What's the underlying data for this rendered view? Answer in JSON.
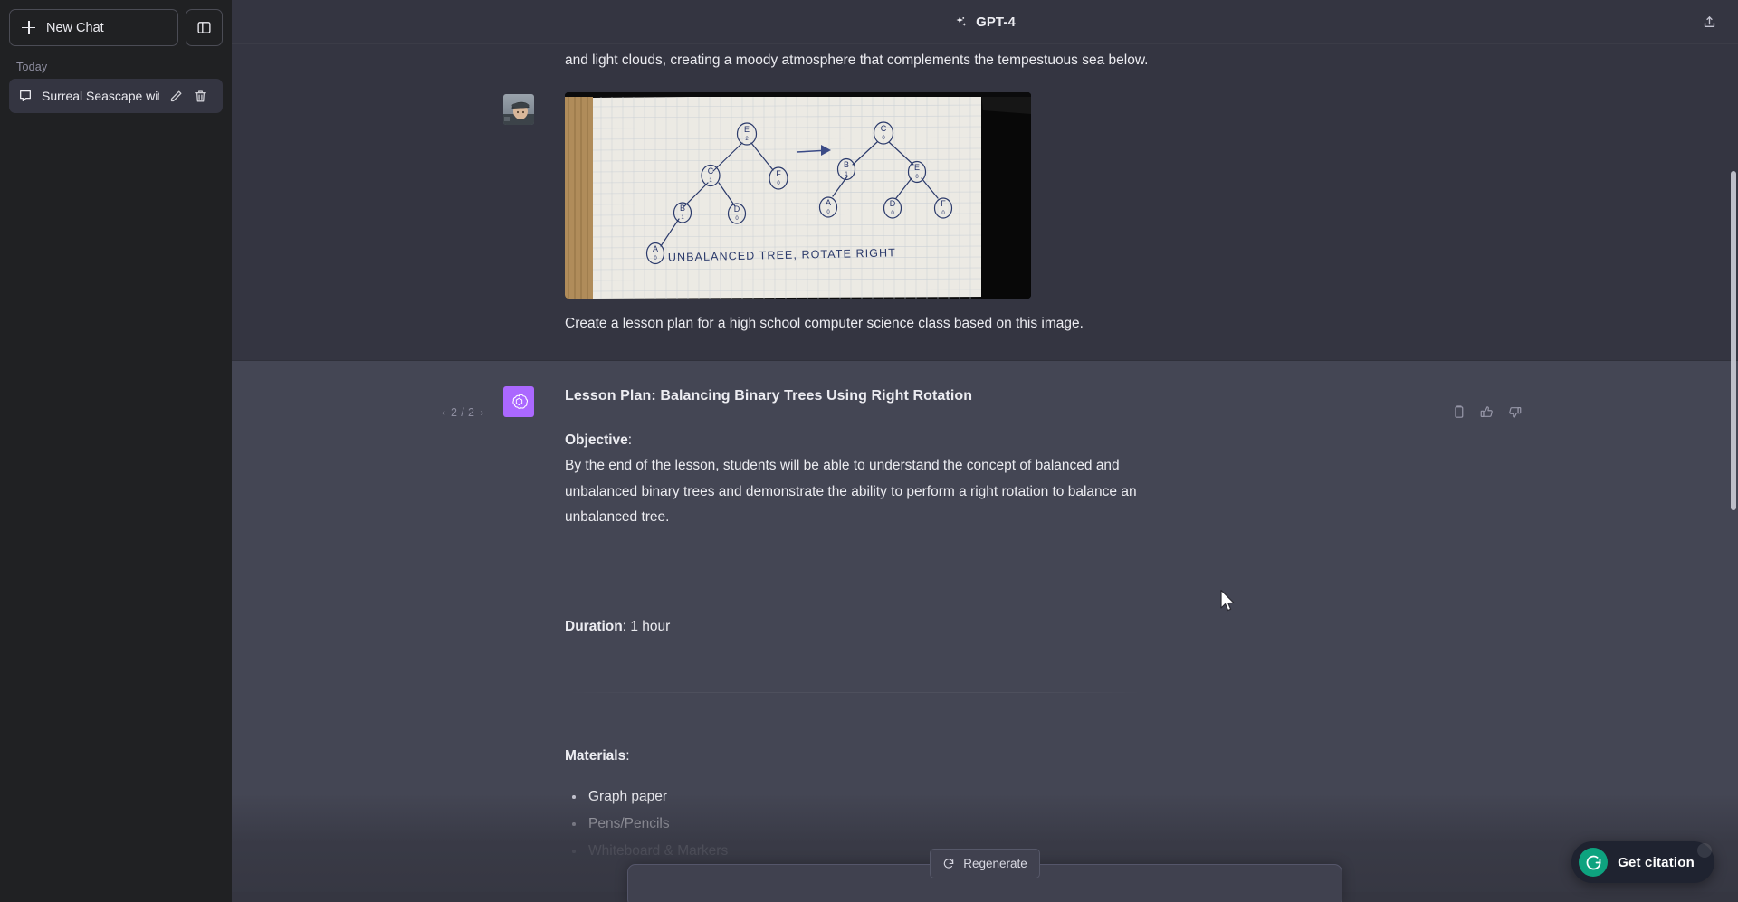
{
  "sidebar": {
    "new_chat_label": "New Chat",
    "new_chat_icon": "plus-icon",
    "panel_toggle_icon": "sidebar-panel-icon",
    "section_label": "Today",
    "chats": [
      {
        "title": "Surreal Seascape with L",
        "icon": "chat-bubble-icon",
        "edit_icon": "pencil-icon",
        "delete_icon": "trash-icon",
        "active": true
      }
    ]
  },
  "header": {
    "model_label": "GPT-4",
    "model_icon": "sparkles-icon",
    "share_icon": "share-upload-icon"
  },
  "conversation": {
    "previous_message_tail": {
      "text": "and light clouds, creating a moody atmosphere that complements the tempestuous sea below."
    },
    "user_turn": {
      "avatar": "user-photo-avatar",
      "attached_image": {
        "alt": "Hand-drawn binary tree rotation diagram on graph paper",
        "caption_in_image": "UNBALANCED TREE, ROTATE RIGHT",
        "left_tree_nodes": [
          "E",
          "C",
          "F",
          "B",
          "D",
          "A"
        ],
        "right_tree_nodes": [
          "C",
          "B",
          "E",
          "A",
          "D",
          "F"
        ]
      },
      "prompt": "Create a lesson plan for a high school computer science class based on this image."
    },
    "assistant_turn": {
      "avatar": "openai-logo-avatar",
      "pager": {
        "prev": "‹",
        "count": "2 / 2",
        "next": "›"
      },
      "actions": [
        {
          "name": "copy-icon",
          "label": "Copy"
        },
        {
          "name": "thumbs-up-icon",
          "label": "Good response"
        },
        {
          "name": "thumbs-down-icon",
          "label": "Bad response"
        }
      ],
      "title": "Lesson Plan: Balancing Binary Trees Using Right Rotation",
      "objective_label": "Objective",
      "objective_text": "By the end of the lesson, students will be able to understand the concept of balanced and unbalanced binary trees and demonstrate the ability to perform a right rotation to balance an unbalanced tree.",
      "duration_label": "Duration",
      "duration_value": "1 hour",
      "materials_label": "Materials",
      "materials": [
        "Graph paper",
        "Pens/Pencils",
        "Whiteboard & Markers"
      ]
    }
  },
  "footer": {
    "regenerate_label": "Regenerate",
    "regenerate_icon": "refresh-icon"
  },
  "citation_widget": {
    "label": "Get citation",
    "icon": "grammarly-g-icon",
    "accent_color": "#0ea37f",
    "background_color": "#1f2330"
  },
  "colors": {
    "sidebar_bg": "#202123",
    "user_turn_bg": "#343541",
    "assistant_turn_bg": "#444654",
    "accent_purple": "#ab68ff",
    "text_primary": "#ececf1",
    "text_muted": "#8e8ea0"
  }
}
